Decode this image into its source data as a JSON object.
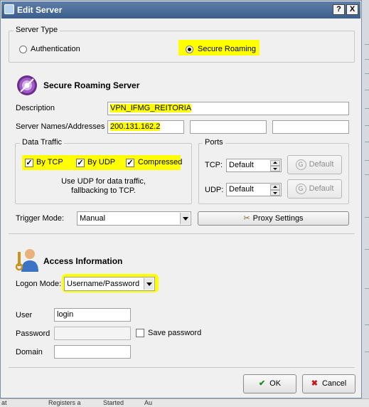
{
  "window": {
    "title": "Edit Server",
    "help_label": "?",
    "close_label": "X"
  },
  "server_type": {
    "label": "Server Type",
    "options": [
      {
        "label": "Authentication",
        "selected": false
      },
      {
        "label": "Secure Roaming",
        "selected": true
      }
    ]
  },
  "secure_roaming": {
    "heading": "Secure Roaming Server",
    "description_label": "Description",
    "description_value": "VPN_IFMG_REITORIA",
    "server_names_label": "Server Names/Addresses",
    "server_names": [
      "200.131.162.2",
      "",
      ""
    ]
  },
  "data_traffic": {
    "label": "Data Traffic",
    "by_tcp": {
      "label": "By TCP",
      "checked": true
    },
    "by_udp": {
      "label": "By UDP",
      "checked": true
    },
    "compressed": {
      "label": "Compressed",
      "checked": true
    },
    "note": "Use UDP for data traffic,\nfallbacking to TCP."
  },
  "ports": {
    "label": "Ports",
    "tcp_label": "TCP:",
    "tcp_value": "Default",
    "tcp_button": "Default",
    "udp_label": "UDP:",
    "udp_value": "Default",
    "udp_button": "Default"
  },
  "trigger": {
    "label": "Trigger Mode:",
    "value": "Manual",
    "proxy_button": "Proxy Settings"
  },
  "access": {
    "heading": "Access Information",
    "logon_mode_label": "Logon Mode:",
    "logon_mode_value": "Username/Password",
    "user_label": "User",
    "user_value": "login",
    "password_label": "Password",
    "password_value": "",
    "save_password_label": "Save password",
    "save_password_checked": false,
    "domain_label": "Domain",
    "domain_value": ""
  },
  "buttons": {
    "ok": "OK",
    "cancel": "Cancel"
  },
  "background_text": [
    "at",
    "Registers a",
    "Started",
    "Au"
  ],
  "colors": {
    "highlight": "#ffff00",
    "titlebar": "#3b5e8c"
  }
}
